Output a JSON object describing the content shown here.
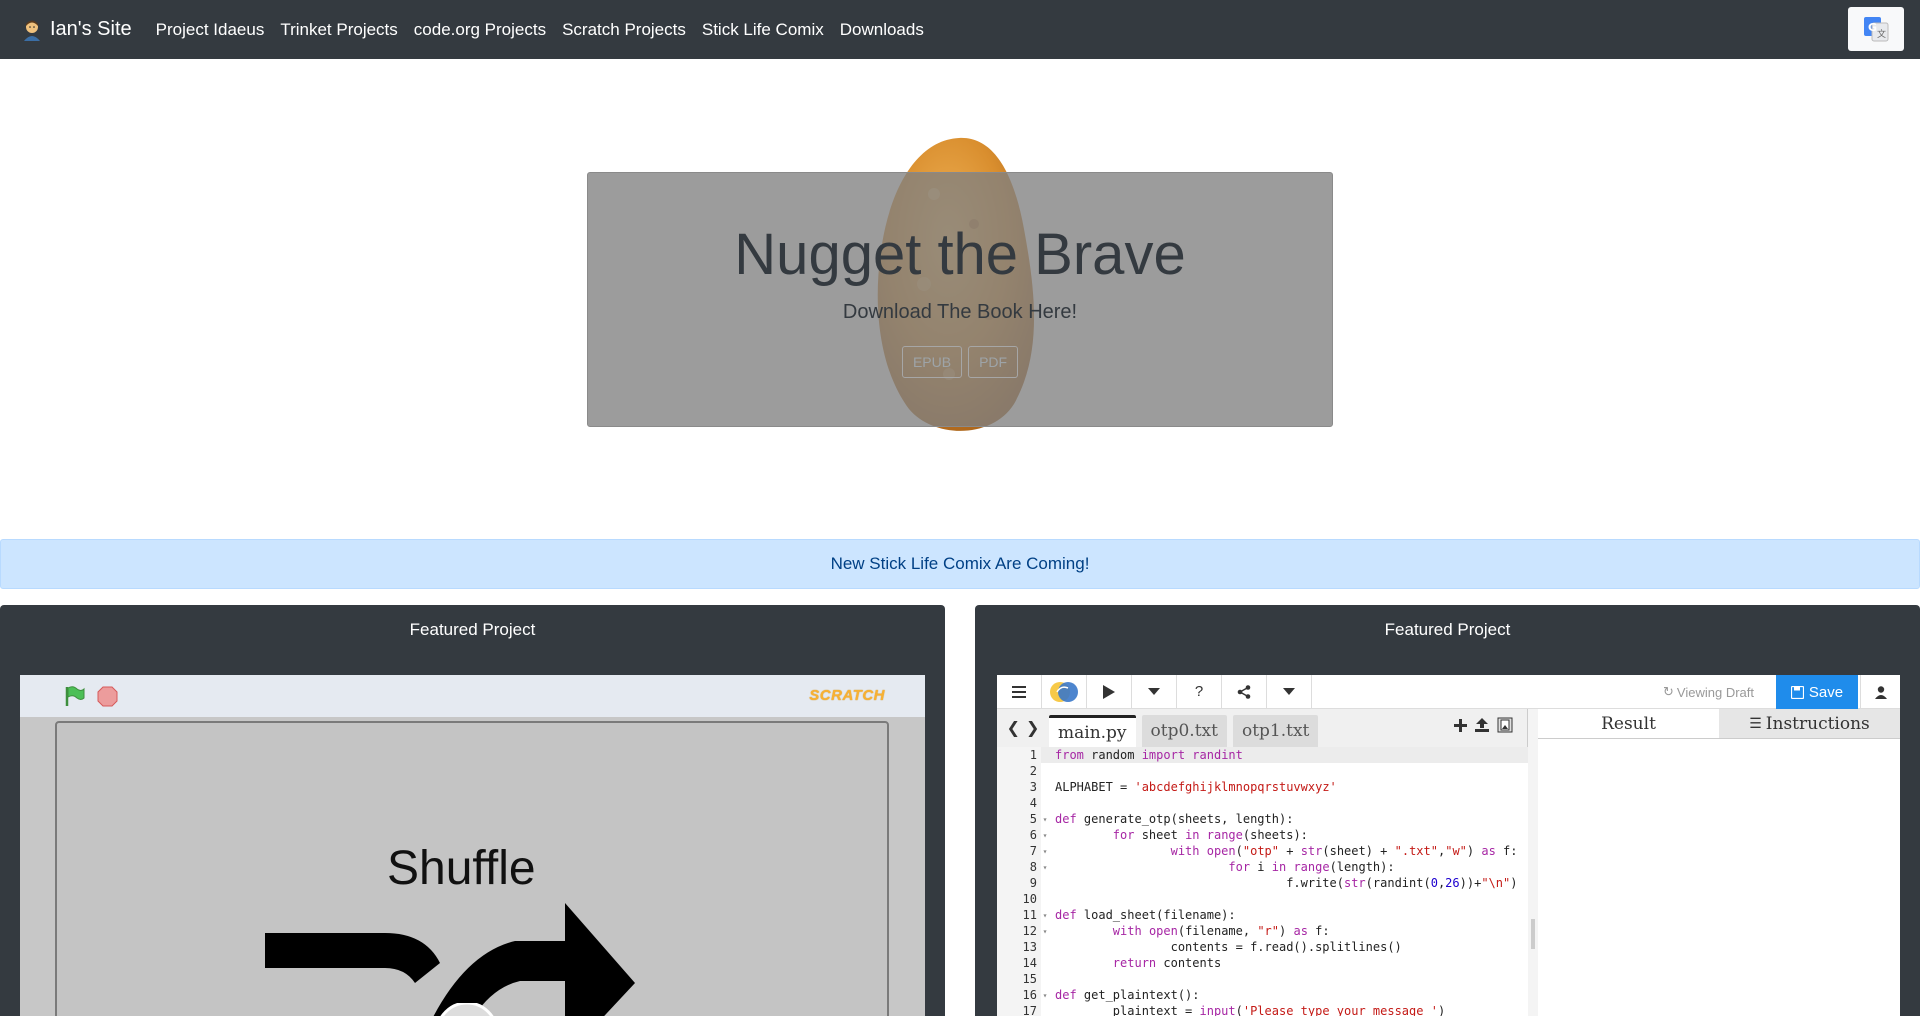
{
  "navbar": {
    "brand": "Ian's Site",
    "links": [
      "Project Idaeus",
      "Trinket Projects",
      "code.org Projects",
      "Scratch Projects",
      "Stick Life Comix",
      "Downloads"
    ]
  },
  "hero": {
    "title": "Nugget the Brave",
    "subtitle": "Download The Book Here!",
    "buttons": [
      "EPUB",
      "PDF"
    ]
  },
  "alert": {
    "text": "New Stick Life Comix Are Coming!"
  },
  "featured_left": {
    "header": "Featured Project",
    "scratch_logo": "SCRATCH",
    "stage_text": "Shuffle"
  },
  "featured_right": {
    "header": "Featured Project",
    "viewing_status": "Viewing Draft",
    "save_label": "Save",
    "files": [
      "main.py",
      "otp0.txt",
      "otp1.txt"
    ],
    "result_tab": "Result",
    "instructions_tab": "Instructions",
    "code_lines": [
      "from random import randint",
      "",
      "ALPHABET = 'abcdefghijklmnopqrstuvwxyz'",
      "",
      "def generate_otp(sheets, length):",
      "        for sheet in range(sheets):",
      "                with open(\"otp\" + str(sheet) + \".txt\",\"w\") as f:",
      "                        for i in range(length):",
      "                                f.write(str(randint(0,26))+\"\\n\")",
      "",
      "def load_sheet(filename):",
      "        with open(filename, \"r\") as f:",
      "                contents = f.read().splitlines()",
      "        return contents",
      "",
      "def get_plaintext():",
      "        plaintext = input('Please type your message ')"
    ],
    "fold_lines": [
      5,
      6,
      7,
      8,
      11,
      12,
      16
    ]
  },
  "colors": {
    "navbar_bg": "#343a40",
    "alert_bg": "#cce5ff",
    "alert_text": "#004085",
    "save_button": "#1f8ceb"
  }
}
